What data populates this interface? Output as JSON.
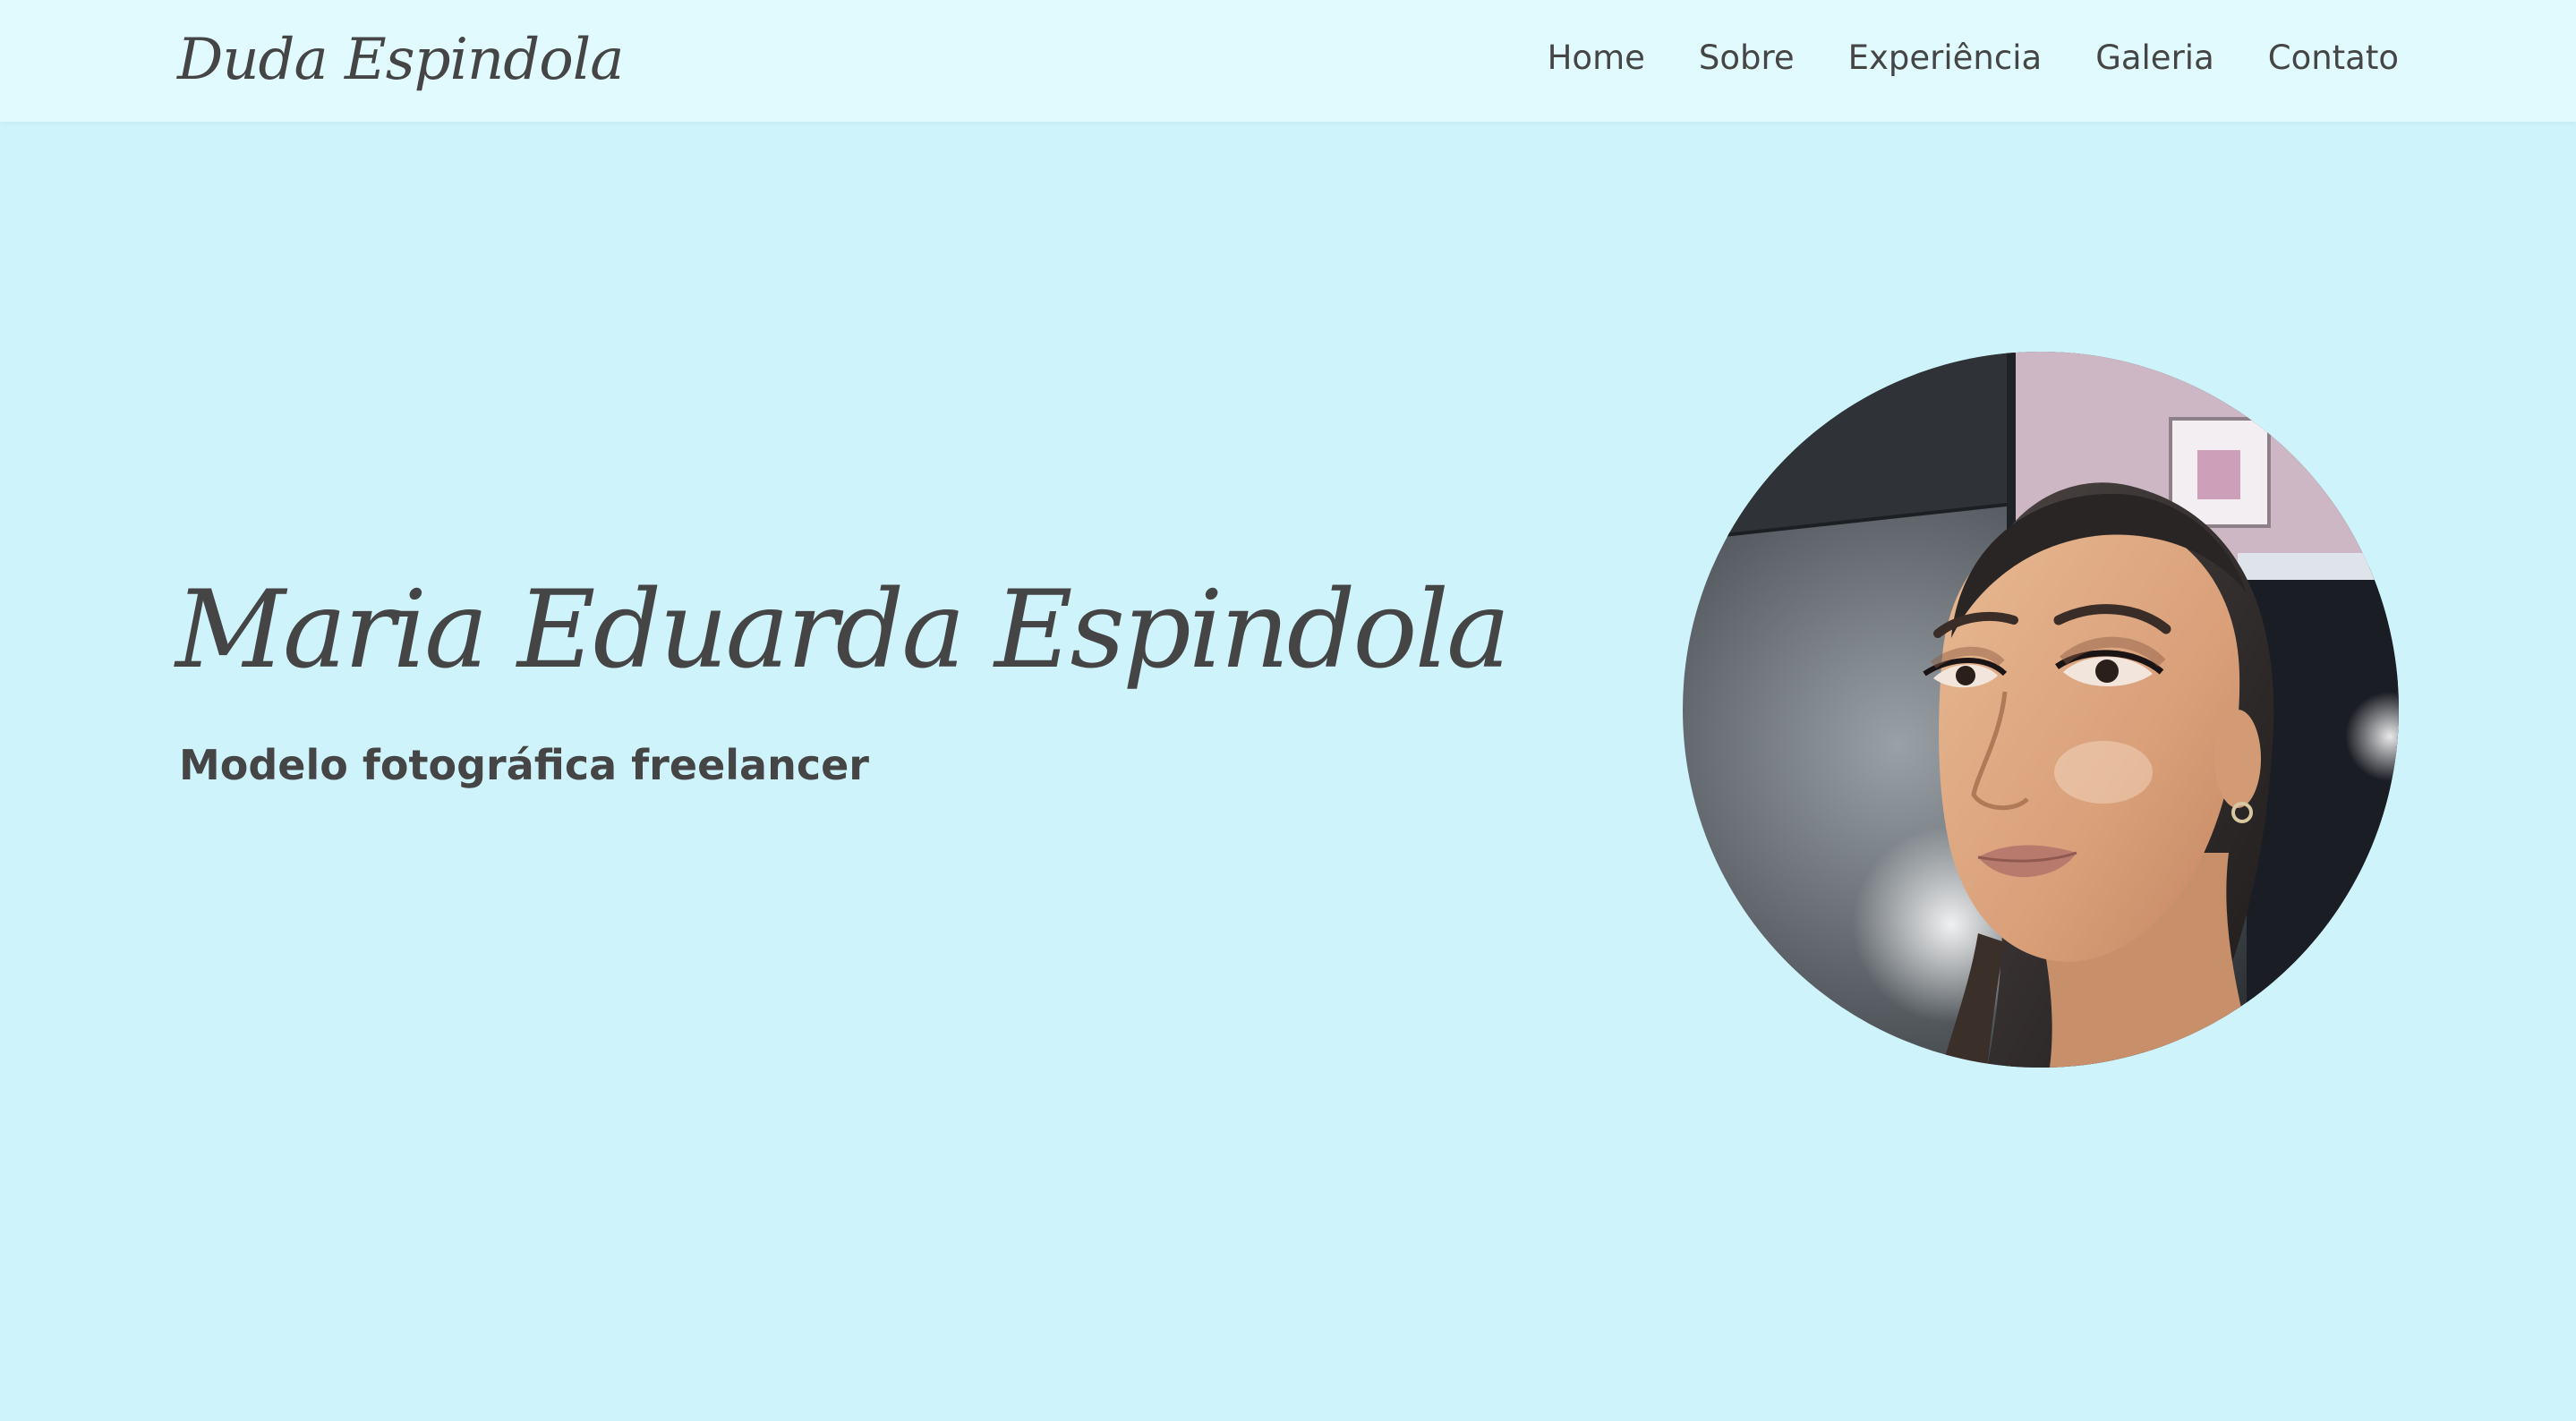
{
  "header": {
    "brand": "Duda Espindola",
    "nav": [
      {
        "label": "Home"
      },
      {
        "label": "Sobre"
      },
      {
        "label": "Experiência"
      },
      {
        "label": "Galeria"
      },
      {
        "label": "Contato"
      }
    ]
  },
  "hero": {
    "name": "Maria Eduarda Espindola",
    "subtitle": "Modelo fotográfica freelancer",
    "photo": "portrait-photo"
  },
  "colors": {
    "page_background": "#cff3fb",
    "navbar_background": "#e1fafe",
    "text": "#454545"
  }
}
